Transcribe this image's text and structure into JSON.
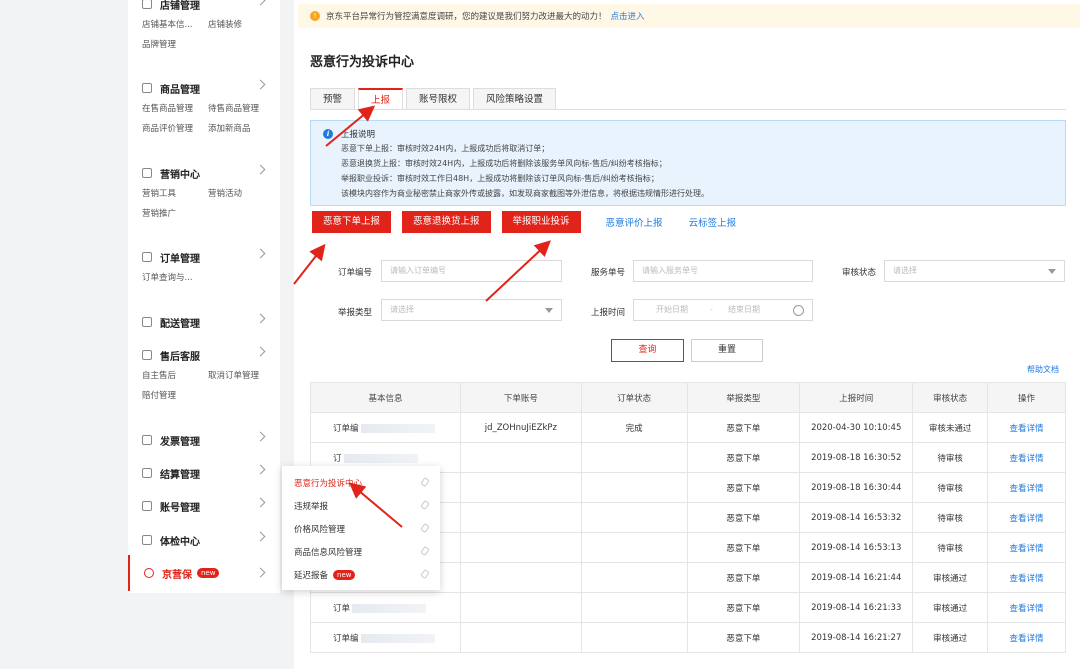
{
  "sidebar": {
    "groups": [
      {
        "label": "店铺管理",
        "subs": [
          "店铺基本信...",
          "店铺装修",
          "品牌管理"
        ]
      },
      {
        "label": "商品管理",
        "subs": [
          "在售商品管理",
          "待售商品管理",
          "商品评价管理",
          "添加新商品"
        ]
      },
      {
        "label": "营销中心",
        "subs": [
          "营销工具",
          "营销活动",
          "营销推广"
        ]
      },
      {
        "label": "订单管理",
        "subs": [
          "订单查询与..."
        ]
      },
      {
        "label": "配送管理",
        "subs": []
      },
      {
        "label": "售后客服",
        "subs": [
          "自主售后",
          "取消订单管理",
          "赔付管理"
        ]
      },
      {
        "label": "发票管理",
        "subs": []
      },
      {
        "label": "结算管理",
        "subs": []
      },
      {
        "label": "账号管理",
        "subs": []
      },
      {
        "label": "体检中心",
        "subs": []
      },
      {
        "label": "京营保",
        "badge": "new",
        "subs": []
      }
    ]
  },
  "popup": {
    "items": [
      {
        "label": "恶意行为投诉中心"
      },
      {
        "label": "违规举报"
      },
      {
        "label": "价格风险管理"
      },
      {
        "label": "商品信息风险管理"
      },
      {
        "label": "延迟报备",
        "badge": "new"
      }
    ]
  },
  "notice": {
    "icon": "warning-icon",
    "text": "京东平台异常行为管控满意度调研，您的建议是我们努力改进最大的动力！",
    "link": "点击进入"
  },
  "page_title": "恶意行为投诉中心",
  "tabs": [
    "预警",
    "上报",
    "账号限权",
    "风险策略设置"
  ],
  "info": {
    "title": "上报说明",
    "lines": [
      "恶意下单上报：审核时效24H内，上报成功后将取消订单；",
      "恶意退换货上报：审核时效24H内，上报成功后将删除该服务单风向标-售后/纠纷考核指标；",
      "举报职业投诉：审核时效工作日48H，上报成功将删除该订单风向标-售后/纠纷考核指标；",
      "该模块内容作为商业秘密禁止商家外传或披露，如发现商家截图等外泄信息，将根据违规情形进行处理。"
    ]
  },
  "actions": {
    "red": [
      "恶意下单上报",
      "恶意退换货上报",
      "举报职业投诉"
    ],
    "links": [
      "恶意评价上报",
      "云标签上报"
    ]
  },
  "form": {
    "order_no_label": "订单编号",
    "order_no_placeholder": "请输入订单编号",
    "service_no_label": "服务单号",
    "service_no_placeholder": "请输入服务单号",
    "audit_label": "审核状态",
    "audit_placeholder": "请选择",
    "type_label": "举报类型",
    "type_placeholder": "请选择",
    "time_label": "上报时间",
    "start_placeholder": "开始日期",
    "date_sep": "-",
    "end_placeholder": "结束日期",
    "query": "查询",
    "reset": "重置",
    "help": "帮助文档"
  },
  "table": {
    "columns": [
      "基本信息",
      "下单账号",
      "订单状态",
      "举报类型",
      "上报时间",
      "审核状态",
      "操作"
    ],
    "rows": [
      {
        "basic": "订单编",
        "account": "jd_ZOHnuJiEZkPz",
        "status": "完成",
        "type": "恶意下单",
        "time": "2020-04-30 10:10:45",
        "audit": "审核未通过",
        "audit_red": true,
        "op": "查看详情"
      },
      {
        "basic": "订",
        "account": "",
        "status": "",
        "type": "恶意下单",
        "time": "2019-08-18 16:30:52",
        "audit": "待审核",
        "op": "查看详情"
      },
      {
        "basic": "",
        "account": "",
        "status": "",
        "type": "恶意下单",
        "time": "2019-08-18 16:30:44",
        "audit": "待审核",
        "op": "查看详情"
      },
      {
        "basic": "",
        "account": "",
        "status": "",
        "type": "恶意下单",
        "time": "2019-08-14 16:53:32",
        "audit": "待审核",
        "op": "查看详情"
      },
      {
        "basic": "",
        "account": "",
        "status": "",
        "type": "恶意下单",
        "time": "2019-08-14 16:53:13",
        "audit": "待审核",
        "op": "查看详情"
      },
      {
        "basic": "",
        "account": "",
        "status": "",
        "type": "恶意下单",
        "time": "2019-08-14 16:21:44",
        "audit": "审核通过",
        "op": "查看详情"
      },
      {
        "basic": "订单",
        "account": "",
        "status": "",
        "type": "恶意下单",
        "time": "2019-08-14 16:21:33",
        "audit": "审核通过",
        "op": "查看详情"
      },
      {
        "basic": "订单编",
        "account": "",
        "status": "",
        "type": "恶意下单",
        "time": "2019-08-14 16:21:27",
        "audit": "审核通过",
        "op": "查看详情"
      }
    ]
  },
  "colors": {
    "accent": "#e2231a",
    "link": "#1f7ae0",
    "info_bg": "#e8f3fe"
  }
}
